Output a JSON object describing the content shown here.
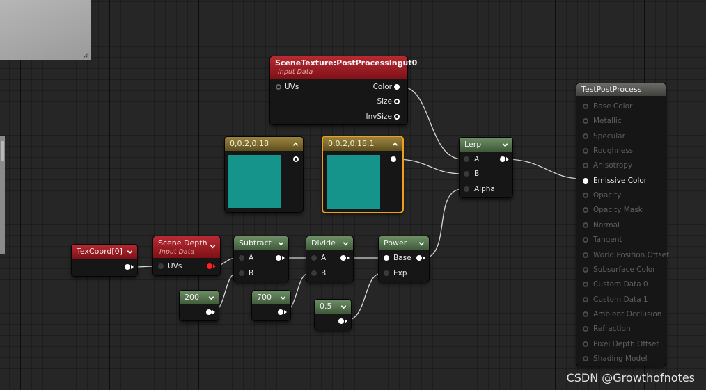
{
  "colors": {
    "swatch": "#14948a",
    "selection": "#f0a018",
    "active_pin": "#ffffff",
    "error_pin": "#ff2020"
  },
  "scene_texture": {
    "title": "SceneTexture:PostProcessInput0",
    "subtitle": "Input Data",
    "inputs": [
      "UVs"
    ],
    "outputs": [
      "Color",
      "Size",
      "InvSize"
    ]
  },
  "const_a": {
    "value": "0,0.2,0.18"
  },
  "const_b": {
    "value": "0,0.2,0.18,1"
  },
  "lerp": {
    "title": "Lerp",
    "inputs": [
      "A",
      "B",
      "Alpha"
    ]
  },
  "material": {
    "title": "TestPostProcess",
    "pins": [
      "Base Color",
      "Metallic",
      "Specular",
      "Roughness",
      "Anisotropy",
      "Emissive Color",
      "Opacity",
      "Opacity Mask",
      "Normal",
      "Tangent",
      "World Position Offset",
      "Subsurface Color",
      "Custom Data 0",
      "Custom Data 1",
      "Ambient Occlusion",
      "Refraction",
      "Pixel Depth Offset",
      "Shading Model"
    ],
    "active_pin": "Emissive Color"
  },
  "texcoord": {
    "title": "TexCoord[0]"
  },
  "scene_depth": {
    "title": "Scene Depth",
    "subtitle": "Input Data",
    "inputs": [
      "UVs"
    ]
  },
  "subtract": {
    "title": "Subtract",
    "inputs": [
      "A",
      "B"
    ]
  },
  "divide": {
    "title": "Divide",
    "inputs": [
      "A",
      "B"
    ]
  },
  "power": {
    "title": "Power",
    "inputs": [
      "Base",
      "Exp"
    ]
  },
  "const_200": {
    "value": "200"
  },
  "const_700": {
    "value": "700"
  },
  "const_05": {
    "value": "0.5"
  },
  "watermark": "CSDN @Growthofnotes"
}
